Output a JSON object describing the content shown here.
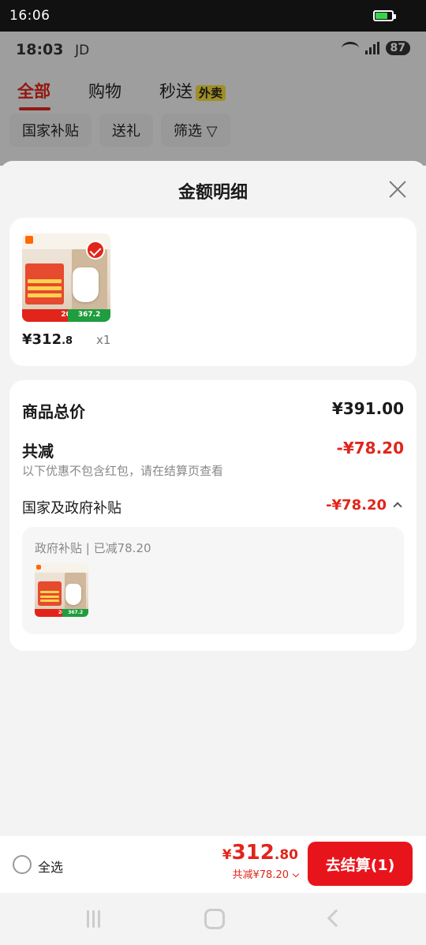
{
  "system": {
    "time": "16:06"
  },
  "inner_status": {
    "time": "18:03",
    "app": "JD",
    "battery": "87",
    "network": "5G"
  },
  "tabs": [
    {
      "label": "全部",
      "active": true
    },
    {
      "label": "购物",
      "active": false
    },
    {
      "label": "秒送",
      "active": false,
      "badge": "外卖"
    }
  ],
  "chips": [
    "国家补贴",
    "送礼",
    "筛选"
  ],
  "sheet": {
    "title": "金额明细",
    "product": {
      "price_int": "¥312",
      "price_dec": ".8",
      "qty": "x1",
      "thumb_label_left": "20%",
      "thumb_label_right": "367.2"
    },
    "summary": {
      "total_label": "商品总价",
      "total_value": "¥391.00",
      "discount_label": "共减",
      "discount_value": "-¥78.20",
      "hint": "以下优惠不包含红包，请在结算页查看",
      "subsidy_label": "国家及政府补贴",
      "subsidy_value": "-¥78.20",
      "subsidy_detail": "政府补贴 | 已减78.20"
    }
  },
  "bottom": {
    "select_all": "全选",
    "currency": "¥",
    "total_int": "312",
    "total_dec": ".80",
    "total_sub": "共减¥78.20",
    "checkout": "去结算(1)"
  },
  "colors": {
    "accent": "#e1251b",
    "checkout": "#e8141c"
  }
}
